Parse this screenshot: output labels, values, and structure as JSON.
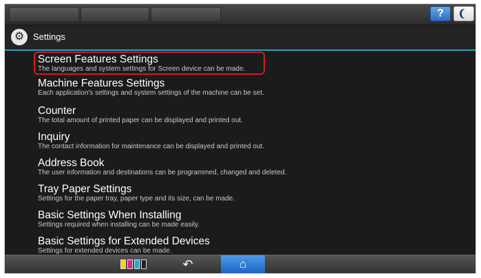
{
  "header": {
    "help_label": "?",
    "title": "Settings"
  },
  "items": [
    {
      "name": "Screen Features Settings",
      "desc": "The languages and system settings for Screen device can be made."
    },
    {
      "name": "Machine Features Settings",
      "desc": "Each application's settings and system settings of the machine can be set."
    },
    {
      "name": "Counter",
      "desc": "The total amount of printed paper can be displayed and printed out."
    },
    {
      "name": "Inquiry",
      "desc": "The contact information for maintenance can be displayed and printed out."
    },
    {
      "name": "Address Book",
      "desc": "The user information and destinations can be programmed, changed and deleted."
    },
    {
      "name": "Tray Paper Settings",
      "desc": "Settings for the paper tray, paper type and its size, can be made."
    },
    {
      "name": "Basic Settings When Installing",
      "desc": "Settings required when installing can be made easily."
    },
    {
      "name": "Basic Settings for Extended Devices",
      "desc": "Settings for extended devices can be made."
    }
  ],
  "footer": {
    "back_icon": "↶",
    "home_icon": "⌂",
    "toner_colors": [
      "#f2d21b",
      "#d6277c",
      "#27a6d8",
      "#222222"
    ]
  },
  "colors": {
    "highlight": "#d01d24",
    "accent": "#1aa6c8"
  }
}
